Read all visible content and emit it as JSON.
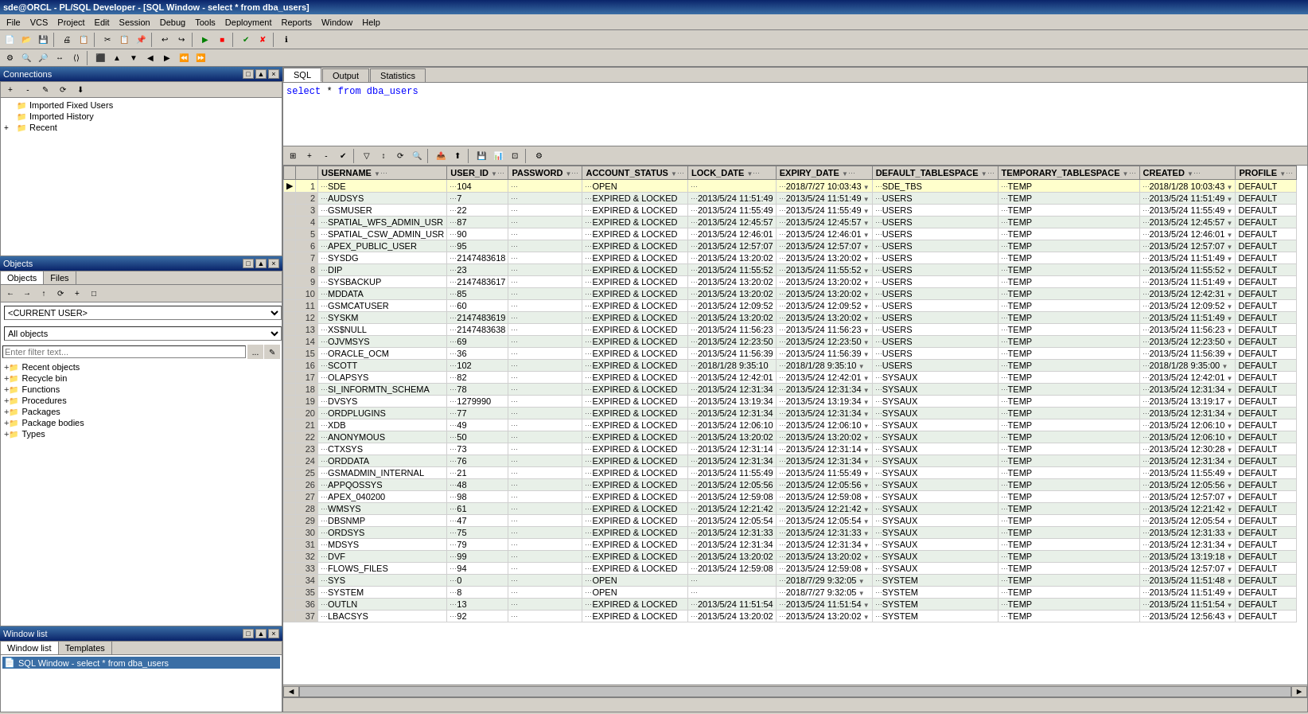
{
  "titleBar": {
    "text": "sde@ORCL - PL/SQL Developer - [SQL Window - select * from dba_users]"
  },
  "menuBar": {
    "items": [
      "File",
      "VCS",
      "Project",
      "Edit",
      "Session",
      "Debug",
      "Tools",
      "Deployment",
      "Reports",
      "Window",
      "Help"
    ]
  },
  "sqlTabs": {
    "tabs": [
      "SQL",
      "Output",
      "Statistics"
    ]
  },
  "sqlEditor": {
    "query": "select * from dba_users"
  },
  "connections": {
    "panelTitle": "Connections",
    "items": [
      {
        "label": "Imported Fixed Users",
        "indent": 1
      },
      {
        "label": "Imported History",
        "indent": 1
      },
      {
        "label": "Recent",
        "indent": 0
      }
    ]
  },
  "objects": {
    "panelTitle": "Objects",
    "tabs": [
      "Objects",
      "Files"
    ],
    "currentUser": "<CURRENT USER>",
    "objectType": "All objects",
    "filterPlaceholder": "Enter filter text..."
  },
  "windowList": {
    "panelTitle": "Window list",
    "tabs": [
      "Window list",
      "Templates"
    ],
    "items": [
      "SQL Window - select * from dba_users"
    ]
  },
  "resultsTable": {
    "columns": [
      "",
      "",
      "USERNAME",
      "",
      "USER_ID",
      "",
      "PASSWORD",
      "",
      "ACCOUNT_STATUS",
      "",
      "LOCK_DATE",
      "",
      "EXPIRY_DATE",
      "",
      "DEFAULT_TABLESPACE",
      "",
      "TEMPORARY_TABLESPACE",
      "",
      "CREATED",
      "",
      "PROFILE",
      ""
    ],
    "displayColumns": [
      "USERNAME",
      "USER_ID",
      "PASSWORD",
      "ACCOUNT_STATUS",
      "LOCK_DATE",
      "EXPIRY_DATE",
      "DEFAULT_TABLESPACE",
      "TEMPORARY_TABLESPACE",
      "CREATED",
      "PROFILE"
    ],
    "rows": [
      {
        "num": 1,
        "username": "SDE",
        "user_id": "104",
        "password": "",
        "account_status": "OPEN",
        "lock_date": "",
        "expiry_date": "2018/7/27 10:03:43",
        "default_tablespace": "SDE_TBS",
        "temporary_tablespace": "TEMP",
        "created": "2018/1/28 10:03:43",
        "profile": "DEFAULT"
      },
      {
        "num": 2,
        "username": "AUDSYS",
        "user_id": "7",
        "password": "",
        "account_status": "EXPIRED & LOCKED",
        "lock_date": "2013/5/24 11:51:49",
        "expiry_date": "2013/5/24 11:51:49",
        "default_tablespace": "USERS",
        "temporary_tablespace": "TEMP",
        "created": "2013/5/24 11:51:49",
        "profile": "DEFAULT"
      },
      {
        "num": 3,
        "username": "GSMUSER",
        "user_id": "22",
        "password": "",
        "account_status": "EXPIRED & LOCKED",
        "lock_date": "2013/5/24 11:55:49",
        "expiry_date": "2013/5/24 11:55:49",
        "default_tablespace": "USERS",
        "temporary_tablespace": "TEMP",
        "created": "2013/5/24 11:55:49",
        "profile": "DEFAULT"
      },
      {
        "num": 4,
        "username": "SPATIAL_WFS_ADMIN_USR",
        "user_id": "87",
        "password": "",
        "account_status": "EXPIRED & LOCKED",
        "lock_date": "2013/5/24 12:45:57",
        "expiry_date": "2013/5/24 12:45:57",
        "default_tablespace": "USERS",
        "temporary_tablespace": "TEMP",
        "created": "2013/5/24 12:45:57",
        "profile": "DEFAULT"
      },
      {
        "num": 5,
        "username": "SPATIAL_CSW_ADMIN_USR",
        "user_id": "90",
        "password": "",
        "account_status": "EXPIRED & LOCKED",
        "lock_date": "2013/5/24 12:46:01",
        "expiry_date": "2013/5/24 12:46:01",
        "default_tablespace": "USERS",
        "temporary_tablespace": "TEMP",
        "created": "2013/5/24 12:46:01",
        "profile": "DEFAULT"
      },
      {
        "num": 6,
        "username": "APEX_PUBLIC_USER",
        "user_id": "95",
        "password": "",
        "account_status": "EXPIRED & LOCKED",
        "lock_date": "2013/5/24 12:57:07",
        "expiry_date": "2013/5/24 12:57:07",
        "default_tablespace": "USERS",
        "temporary_tablespace": "TEMP",
        "created": "2013/5/24 12:57:07",
        "profile": "DEFAULT"
      },
      {
        "num": 7,
        "username": "SYSDG",
        "user_id": "2147483618",
        "password": "",
        "account_status": "EXPIRED & LOCKED",
        "lock_date": "2013/5/24 13:20:02",
        "expiry_date": "2013/5/24 13:20:02",
        "default_tablespace": "USERS",
        "temporary_tablespace": "TEMP",
        "created": "2013/5/24 11:51:49",
        "profile": "DEFAULT"
      },
      {
        "num": 8,
        "username": "DIP",
        "user_id": "23",
        "password": "",
        "account_status": "EXPIRED & LOCKED",
        "lock_date": "2013/5/24 11:55:52",
        "expiry_date": "2013/5/24 11:55:52",
        "default_tablespace": "USERS",
        "temporary_tablespace": "TEMP",
        "created": "2013/5/24 11:55:52",
        "profile": "DEFAULT"
      },
      {
        "num": 9,
        "username": "SYSBACKUP",
        "user_id": "2147483617",
        "password": "",
        "account_status": "EXPIRED & LOCKED",
        "lock_date": "2013/5/24 13:20:02",
        "expiry_date": "2013/5/24 13:20:02",
        "default_tablespace": "USERS",
        "temporary_tablespace": "TEMP",
        "created": "2013/5/24 11:51:49",
        "profile": "DEFAULT"
      },
      {
        "num": 10,
        "username": "MDDATA",
        "user_id": "85",
        "password": "",
        "account_status": "EXPIRED & LOCKED",
        "lock_date": "2013/5/24 13:20:02",
        "expiry_date": "2013/5/24 13:20:02",
        "default_tablespace": "USERS",
        "temporary_tablespace": "TEMP",
        "created": "2013/5/24 12:42:31",
        "profile": "DEFAULT"
      },
      {
        "num": 11,
        "username": "GSMCATUSER",
        "user_id": "60",
        "password": "",
        "account_status": "EXPIRED & LOCKED",
        "lock_date": "2013/5/24 12:09:52",
        "expiry_date": "2013/5/24 12:09:52",
        "default_tablespace": "USERS",
        "temporary_tablespace": "TEMP",
        "created": "2013/5/24 12:09:52",
        "profile": "DEFAULT"
      },
      {
        "num": 12,
        "username": "SYSKM",
        "user_id": "2147483619",
        "password": "",
        "account_status": "EXPIRED & LOCKED",
        "lock_date": "2013/5/24 13:20:02",
        "expiry_date": "2013/5/24 13:20:02",
        "default_tablespace": "USERS",
        "temporary_tablespace": "TEMP",
        "created": "2013/5/24 11:51:49",
        "profile": "DEFAULT"
      },
      {
        "num": 13,
        "username": "XS$NULL",
        "user_id": "2147483638",
        "password": "",
        "account_status": "EXPIRED & LOCKED",
        "lock_date": "2013/5/24 11:56:23",
        "expiry_date": "2013/5/24 11:56:23",
        "default_tablespace": "USERS",
        "temporary_tablespace": "TEMP",
        "created": "2013/5/24 11:56:23",
        "profile": "DEFAULT"
      },
      {
        "num": 14,
        "username": "OJVMSYS",
        "user_id": "69",
        "password": "",
        "account_status": "EXPIRED & LOCKED",
        "lock_date": "2013/5/24 12:23:50",
        "expiry_date": "2013/5/24 12:23:50",
        "default_tablespace": "USERS",
        "temporary_tablespace": "TEMP",
        "created": "2013/5/24 12:23:50",
        "profile": "DEFAULT"
      },
      {
        "num": 15,
        "username": "ORACLE_OCM",
        "user_id": "36",
        "password": "",
        "account_status": "EXPIRED & LOCKED",
        "lock_date": "2013/5/24 11:56:39",
        "expiry_date": "2013/5/24 11:56:39",
        "default_tablespace": "USERS",
        "temporary_tablespace": "TEMP",
        "created": "2013/5/24 11:56:39",
        "profile": "DEFAULT"
      },
      {
        "num": 16,
        "username": "SCOTT",
        "user_id": "102",
        "password": "",
        "account_status": "EXPIRED & LOCKED",
        "lock_date": "2018/1/28 9:35:10",
        "expiry_date": "2018/1/28 9:35:10",
        "default_tablespace": "USERS",
        "temporary_tablespace": "TEMP",
        "created": "2018/1/28 9:35:00",
        "profile": "DEFAULT"
      },
      {
        "num": 17,
        "username": "OLAPSYS",
        "user_id": "82",
        "password": "",
        "account_status": "EXPIRED & LOCKED",
        "lock_date": "2013/5/24 12:42:01",
        "expiry_date": "2013/5/24 12:42:01",
        "default_tablespace": "SYSAUX",
        "temporary_tablespace": "TEMP",
        "created": "2013/5/24 12:42:01",
        "profile": "DEFAULT"
      },
      {
        "num": 18,
        "username": "SI_INFORMTN_SCHEMA",
        "user_id": "78",
        "password": "",
        "account_status": "EXPIRED & LOCKED",
        "lock_date": "2013/5/24 12:31:34",
        "expiry_date": "2013/5/24 12:31:34",
        "default_tablespace": "SYSAUX",
        "temporary_tablespace": "TEMP",
        "created": "2013/5/24 12:31:34",
        "profile": "DEFAULT"
      },
      {
        "num": 19,
        "username": "DVSYS",
        "user_id": "1279990",
        "password": "",
        "account_status": "EXPIRED & LOCKED",
        "lock_date": "2013/5/24 13:19:34",
        "expiry_date": "2013/5/24 13:19:34",
        "default_tablespace": "SYSAUX",
        "temporary_tablespace": "TEMP",
        "created": "2013/5/24 13:19:17",
        "profile": "DEFAULT"
      },
      {
        "num": 20,
        "username": "ORDPLUGINS",
        "user_id": "77",
        "password": "",
        "account_status": "EXPIRED & LOCKED",
        "lock_date": "2013/5/24 12:31:34",
        "expiry_date": "2013/5/24 12:31:34",
        "default_tablespace": "SYSAUX",
        "temporary_tablespace": "TEMP",
        "created": "2013/5/24 12:31:34",
        "profile": "DEFAULT"
      },
      {
        "num": 21,
        "username": "XDB",
        "user_id": "49",
        "password": "",
        "account_status": "EXPIRED & LOCKED",
        "lock_date": "2013/5/24 12:06:10",
        "expiry_date": "2013/5/24 12:06:10",
        "default_tablespace": "SYSAUX",
        "temporary_tablespace": "TEMP",
        "created": "2013/5/24 12:06:10",
        "profile": "DEFAULT"
      },
      {
        "num": 22,
        "username": "ANONYMOUS",
        "user_id": "50",
        "password": "",
        "account_status": "EXPIRED & LOCKED",
        "lock_date": "2013/5/24 13:20:02",
        "expiry_date": "2013/5/24 13:20:02",
        "default_tablespace": "SYSAUX",
        "temporary_tablespace": "TEMP",
        "created": "2013/5/24 12:06:10",
        "profile": "DEFAULT"
      },
      {
        "num": 23,
        "username": "CTXSYS",
        "user_id": "73",
        "password": "",
        "account_status": "EXPIRED & LOCKED",
        "lock_date": "2013/5/24 12:31:14",
        "expiry_date": "2013/5/24 12:31:14",
        "default_tablespace": "SYSAUX",
        "temporary_tablespace": "TEMP",
        "created": "2013/5/24 12:30:28",
        "profile": "DEFAULT"
      },
      {
        "num": 24,
        "username": "ORDDATA",
        "user_id": "76",
        "password": "",
        "account_status": "EXPIRED & LOCKED",
        "lock_date": "2013/5/24 12:31:34",
        "expiry_date": "2013/5/24 12:31:34",
        "default_tablespace": "SYSAUX",
        "temporary_tablespace": "TEMP",
        "created": "2013/5/24 12:31:34",
        "profile": "DEFAULT"
      },
      {
        "num": 25,
        "username": "GSMADMIN_INTERNAL",
        "user_id": "21",
        "password": "",
        "account_status": "EXPIRED & LOCKED",
        "lock_date": "2013/5/24 11:55:49",
        "expiry_date": "2013/5/24 11:55:49",
        "default_tablespace": "SYSAUX",
        "temporary_tablespace": "TEMP",
        "created": "2013/5/24 11:55:49",
        "profile": "DEFAULT"
      },
      {
        "num": 26,
        "username": "APPQOSSYS",
        "user_id": "48",
        "password": "",
        "account_status": "EXPIRED & LOCKED",
        "lock_date": "2013/5/24 12:05:56",
        "expiry_date": "2013/5/24 12:05:56",
        "default_tablespace": "SYSAUX",
        "temporary_tablespace": "TEMP",
        "created": "2013/5/24 12:05:56",
        "profile": "DEFAULT"
      },
      {
        "num": 27,
        "username": "APEX_040200",
        "user_id": "98",
        "password": "",
        "account_status": "EXPIRED & LOCKED",
        "lock_date": "2013/5/24 12:59:08",
        "expiry_date": "2013/5/24 12:59:08",
        "default_tablespace": "SYSAUX",
        "temporary_tablespace": "TEMP",
        "created": "2013/5/24 12:57:07",
        "profile": "DEFAULT"
      },
      {
        "num": 28,
        "username": "WMSYS",
        "user_id": "61",
        "password": "",
        "account_status": "EXPIRED & LOCKED",
        "lock_date": "2013/5/24 12:21:42",
        "expiry_date": "2013/5/24 12:21:42",
        "default_tablespace": "SYSAUX",
        "temporary_tablespace": "TEMP",
        "created": "2013/5/24 12:21:42",
        "profile": "DEFAULT"
      },
      {
        "num": 29,
        "username": "DBSNMP",
        "user_id": "47",
        "password": "",
        "account_status": "EXPIRED & LOCKED",
        "lock_date": "2013/5/24 12:05:54",
        "expiry_date": "2013/5/24 12:05:54",
        "default_tablespace": "SYSAUX",
        "temporary_tablespace": "TEMP",
        "created": "2013/5/24 12:05:54",
        "profile": "DEFAULT"
      },
      {
        "num": 30,
        "username": "ORDSYS",
        "user_id": "75",
        "password": "",
        "account_status": "EXPIRED & LOCKED",
        "lock_date": "2013/5/24 12:31:33",
        "expiry_date": "2013/5/24 12:31:33",
        "default_tablespace": "SYSAUX",
        "temporary_tablespace": "TEMP",
        "created": "2013/5/24 12:31:33",
        "profile": "DEFAULT"
      },
      {
        "num": 31,
        "username": "MDSYS",
        "user_id": "79",
        "password": "",
        "account_status": "EXPIRED & LOCKED",
        "lock_date": "2013/5/24 12:31:34",
        "expiry_date": "2013/5/24 12:31:34",
        "default_tablespace": "SYSAUX",
        "temporary_tablespace": "TEMP",
        "created": "2013/5/24 12:31:34",
        "profile": "DEFAULT"
      },
      {
        "num": 32,
        "username": "DVF",
        "user_id": "99",
        "password": "",
        "account_status": "EXPIRED & LOCKED",
        "lock_date": "2013/5/24 13:20:02",
        "expiry_date": "2013/5/24 13:20:02",
        "default_tablespace": "SYSAUX",
        "temporary_tablespace": "TEMP",
        "created": "2013/5/24 13:19:18",
        "profile": "DEFAULT"
      },
      {
        "num": 33,
        "username": "FLOWS_FILES",
        "user_id": "94",
        "password": "",
        "account_status": "EXPIRED & LOCKED",
        "lock_date": "2013/5/24 12:59:08",
        "expiry_date": "2013/5/24 12:59:08",
        "default_tablespace": "SYSAUX",
        "temporary_tablespace": "TEMP",
        "created": "2013/5/24 12:57:07",
        "profile": "DEFAULT"
      },
      {
        "num": 34,
        "username": "SYS",
        "user_id": "0",
        "password": "",
        "account_status": "OPEN",
        "lock_date": "",
        "expiry_date": "2018/7/29 9:32:05",
        "default_tablespace": "SYSTEM",
        "temporary_tablespace": "TEMP",
        "created": "2013/5/24 11:51:48",
        "profile": "DEFAULT"
      },
      {
        "num": 35,
        "username": "SYSTEM",
        "user_id": "8",
        "password": "",
        "account_status": "OPEN",
        "lock_date": "",
        "expiry_date": "2018/7/27 9:32:05",
        "default_tablespace": "SYSTEM",
        "temporary_tablespace": "TEMP",
        "created": "2013/5/24 11:51:49",
        "profile": "DEFAULT"
      },
      {
        "num": 36,
        "username": "OUTLN",
        "user_id": "13",
        "password": "",
        "account_status": "EXPIRED & LOCKED",
        "lock_date": "2013/5/24 11:51:54",
        "expiry_date": "2013/5/24 11:51:54",
        "default_tablespace": "SYSTEM",
        "temporary_tablespace": "TEMP",
        "created": "2013/5/24 11:51:54",
        "profile": "DEFAULT"
      },
      {
        "num": 37,
        "username": "LBACSYS",
        "user_id": "92",
        "password": "",
        "account_status": "EXPIRED & LOCKED",
        "lock_date": "2013/5/24 13:20:02",
        "expiry_date": "2013/5/24 13:20:02",
        "default_tablespace": "SYSTEM",
        "temporary_tablespace": "TEMP",
        "created": "2013/5/24 12:56:43",
        "profile": "DEFAULT"
      }
    ]
  },
  "objectsTree": {
    "items": [
      "Recent objects",
      "Recycle bin",
      "Functions",
      "Procedures",
      "Packages",
      "Package bodies",
      "Types"
    ]
  }
}
